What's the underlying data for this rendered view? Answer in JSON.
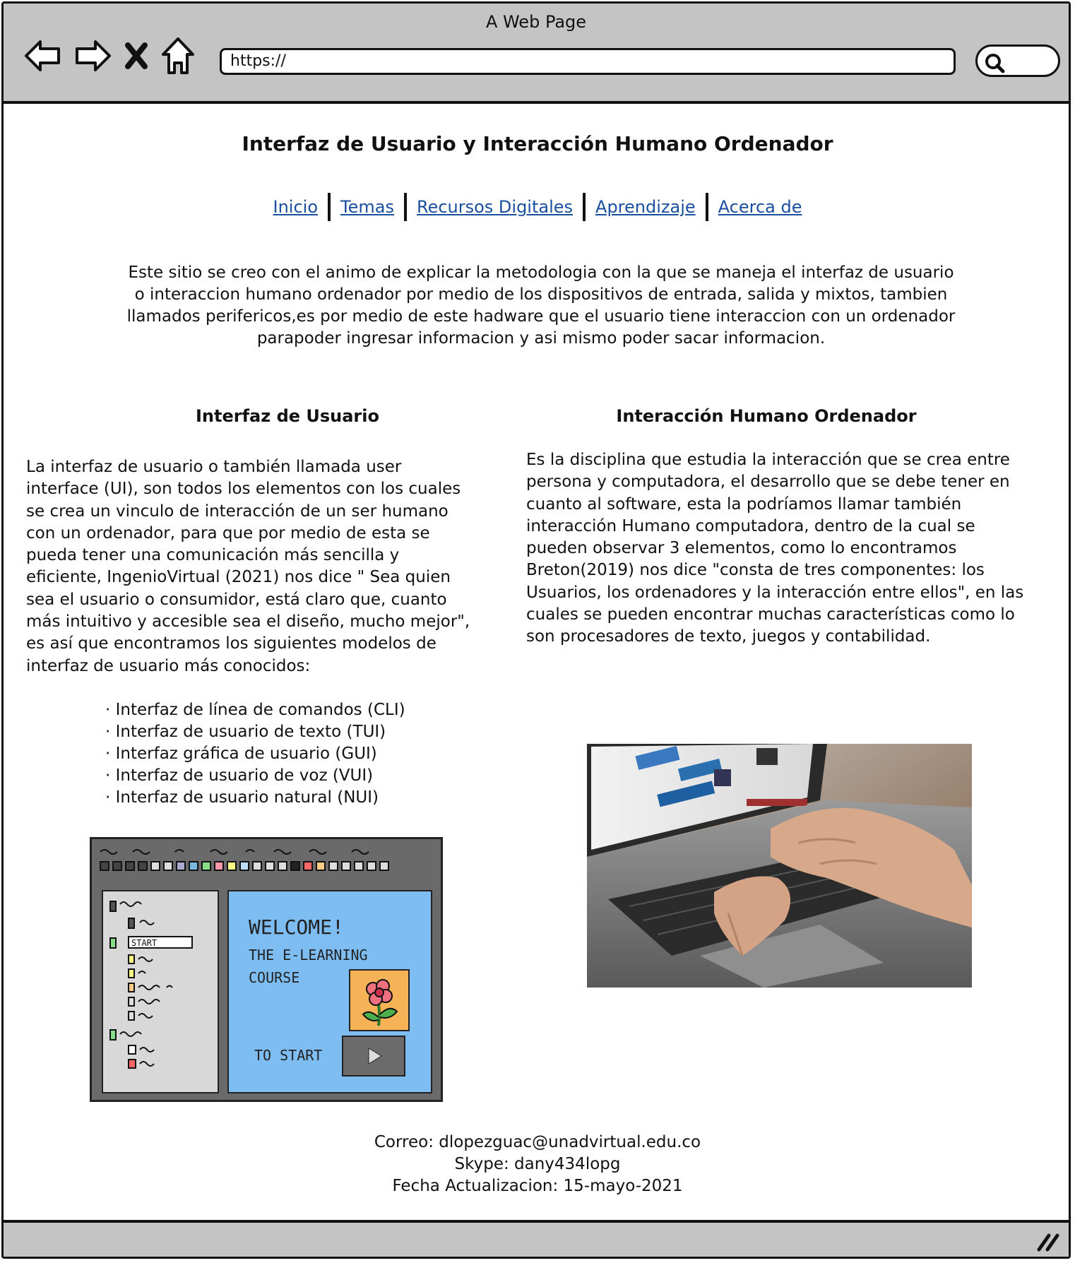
{
  "browser": {
    "window_title": "A Web Page",
    "url": "https://"
  },
  "page": {
    "title": "Interfaz de Usuario y Interacción Humano Ordenador",
    "nav": [
      "Inicio",
      "Temas",
      "Recursos Digitales",
      "Aprendizaje",
      "Acerca de"
    ],
    "intro": "Este sitio se creo con el animo de explicar la metodologia con la que se maneja el interfaz de usuario o interaccion humano ordenador por medio de los dispositivos de entrada, salida y mixtos, tambien llamados perifericos,es por medio de este hadware que el usuario tiene interaccion con un ordenador parapoder ingresar informacion y asi mismo poder sacar informacion."
  },
  "left": {
    "heading": "Interfaz de Usuario",
    "body": "La interfaz de usuario o también llamada user interface (UI), son todos los elementos con los cuales se crea un vinculo de interacción de un ser humano con un ordenador, para que por medio de esta se pueda tener una comunicación más sencilla y eficiente, IngenioVirtual (2021) nos dice \" Sea quien sea el usuario o consumidor, está claro que, cuanto más intuitivo y accesible sea el diseño, mucho mejor\", es así que encontramos los siguientes modelos de interfaz de usuario más conocidos:",
    "bullets": [
      "· Interfaz de línea de comandos (CLI)",
      "· Interfaz de usuario de texto (TUI)",
      "· Interfaz gráfica de usuario (GUI)",
      "· Interfaz de usuario de voz (VUI)",
      "· Interfaz de usuario natural (NUI)"
    ],
    "image": {
      "welcome": "WELCOME!",
      "course_line1": "THE E-LEARNING",
      "course_line2": "COURSE",
      "start_item": "START",
      "to_start": "TO START"
    }
  },
  "right": {
    "heading": "Interacción Humano Ordenador",
    "body": "Es la disciplina que estudia la interacción que se crea entre persona y computadora, el desarrollo que se debe tener en cuanto al software, esta la podríamos llamar también interacción Humano computadora, dentro de la cual se pueden observar 3 elementos, como lo encontramos Breton(2019) nos dice \"consta de tres componentes: los Usuarios, los ordenadores y la interacción entre ellos\", en las cuales se pueden encontrar muchas características como lo son procesadores de texto, juegos y contabilidad."
  },
  "footer": {
    "email": "Correo: dlopezguac@unadvirtual.edu.co",
    "skype": "Skype: dany434lopg",
    "updated": "Fecha Actualizacion: 15-mayo-2021"
  },
  "colors": {
    "chrome": "#c4c4c4",
    "link": "#1a4fa0",
    "sketch_canvas": "#7dbdf2"
  }
}
